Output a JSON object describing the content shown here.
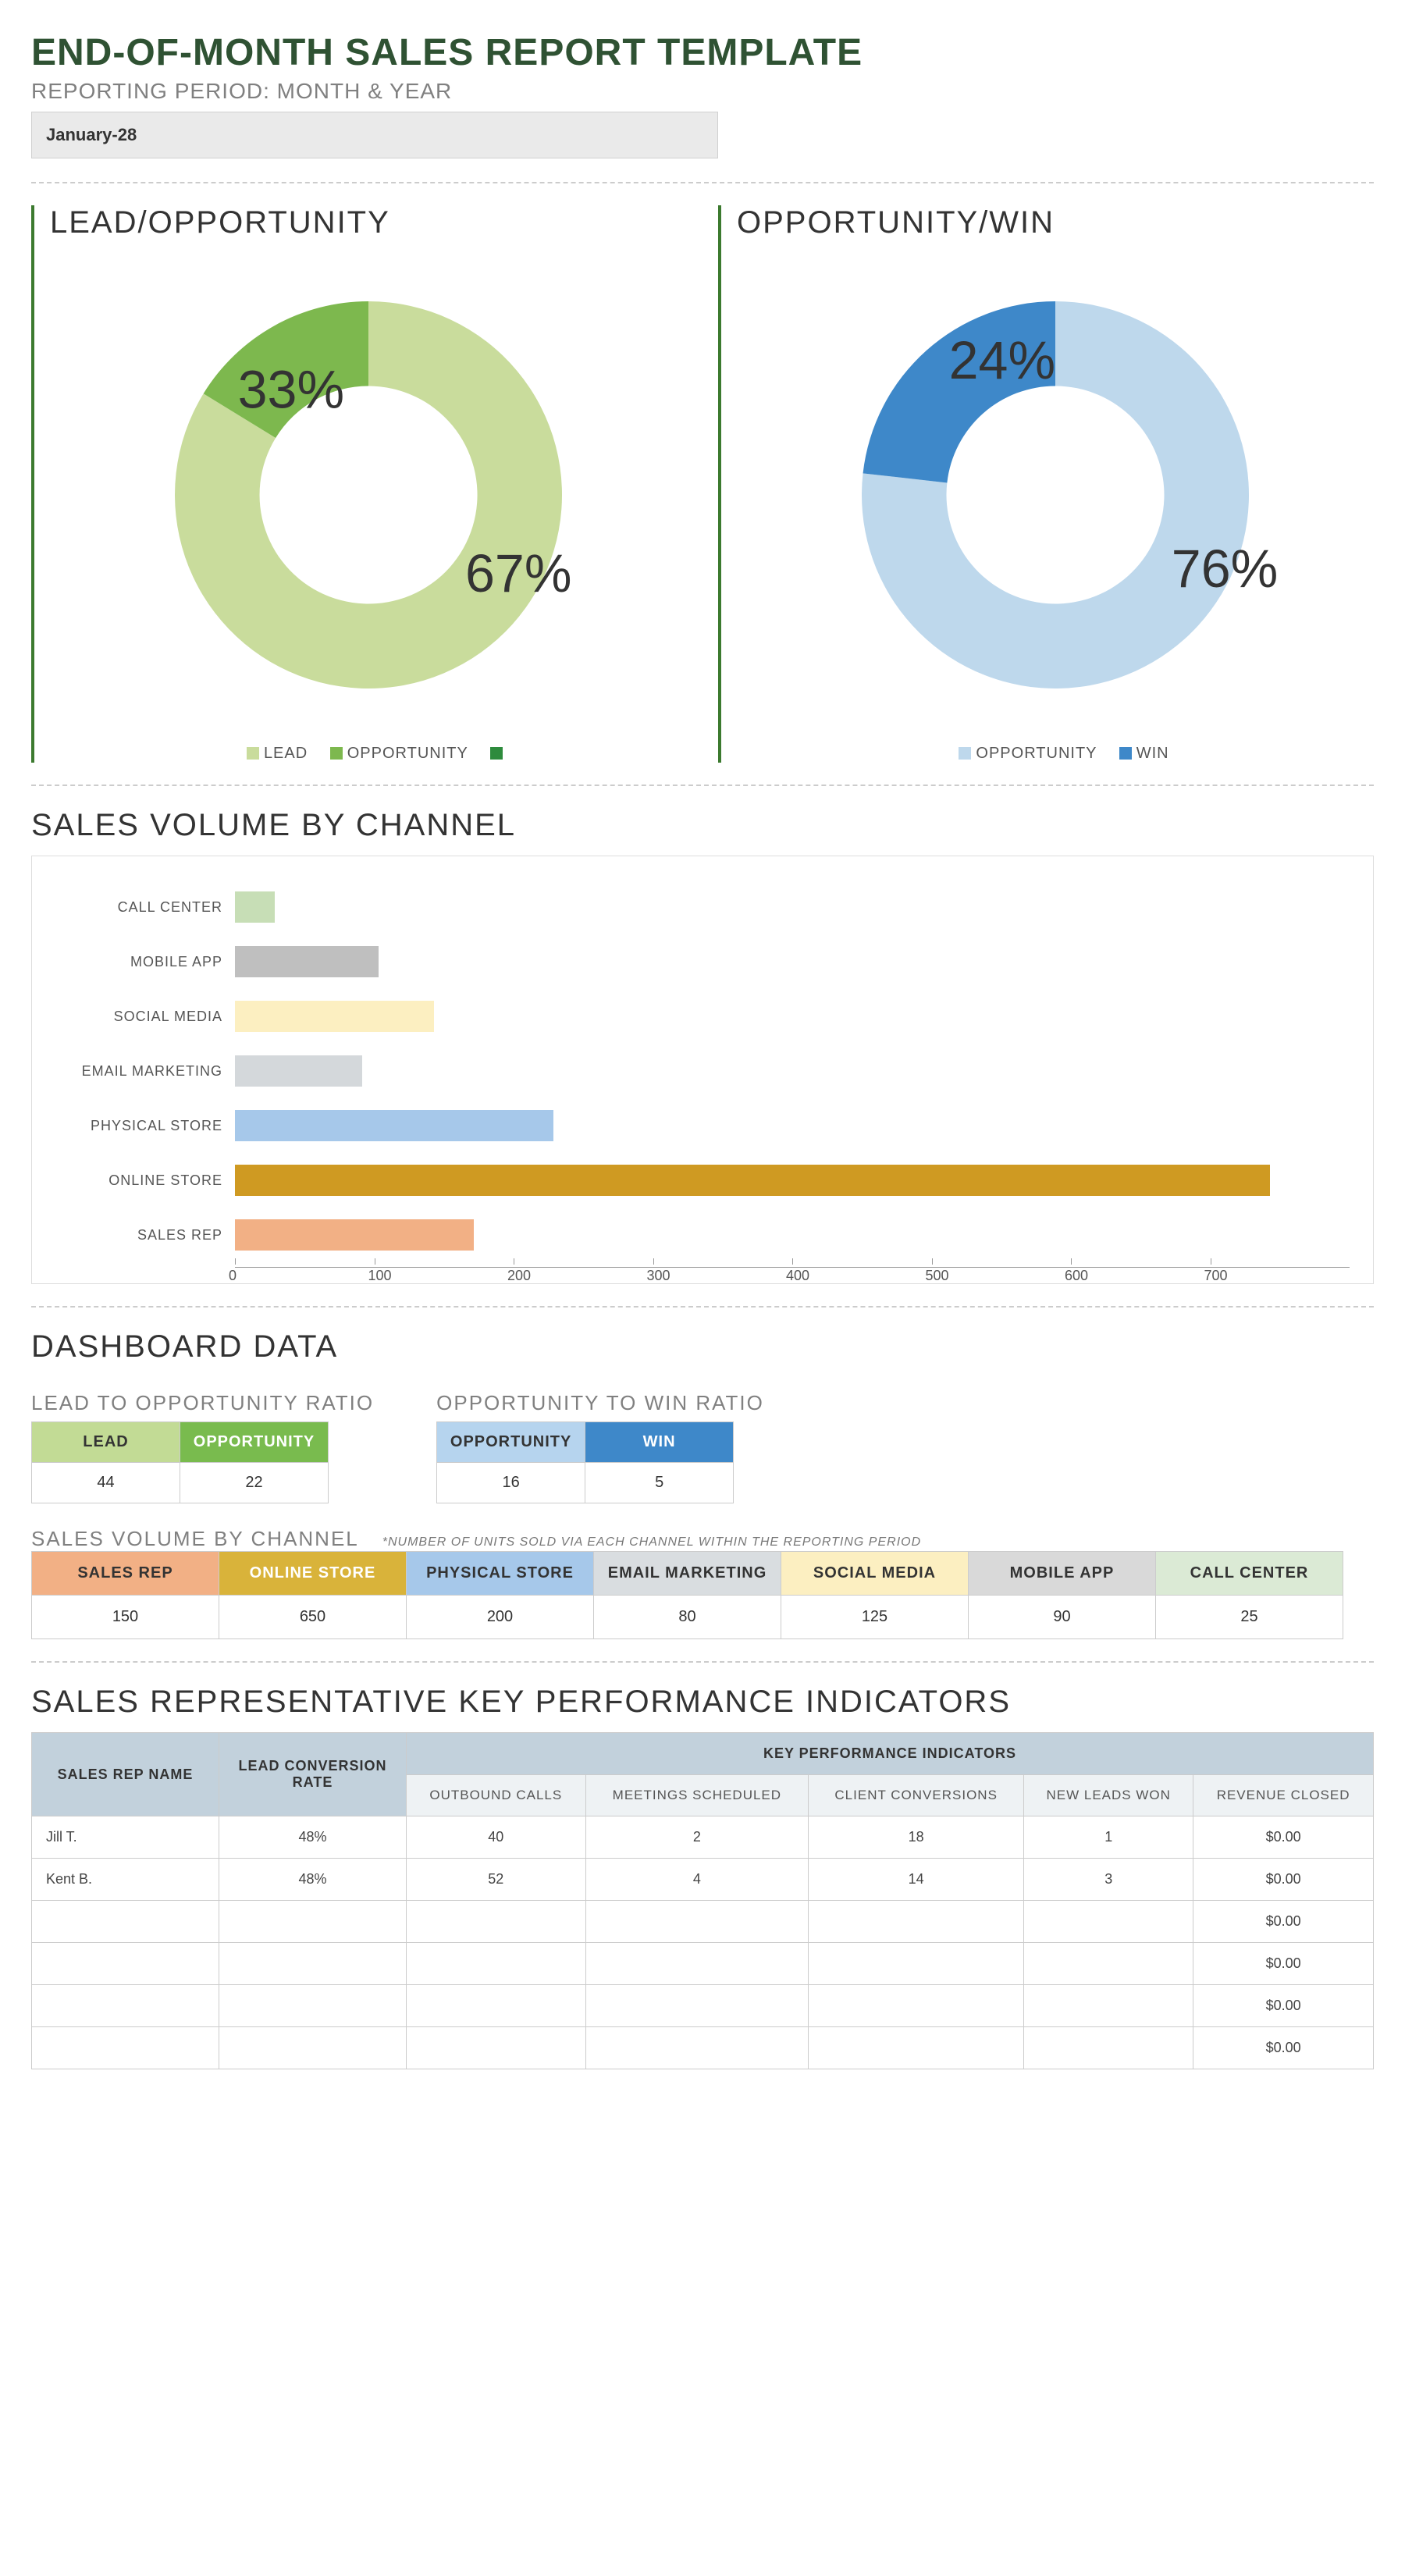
{
  "header": {
    "title": "END-OF-MONTH SALES REPORT TEMPLATE",
    "subtitle": "REPORTING PERIOD: MONTH & YEAR",
    "period": "January-28"
  },
  "donut_lead": {
    "title": "LEAD/OPPORTUNITY",
    "legend": [
      "LEAD",
      "OPPORTUNITY"
    ],
    "label_a": "67%",
    "label_b": "33%"
  },
  "donut_win": {
    "title": "OPPORTUNITY/WIN",
    "legend": [
      "OPPORTUNITY",
      "WIN"
    ],
    "label_a": "76%",
    "label_b": "24%"
  },
  "bar_section": {
    "title": "SALES VOLUME BY CHANNEL",
    "ticks": [
      "0",
      "100",
      "200",
      "300",
      "400",
      "500",
      "600",
      "700"
    ]
  },
  "dashboard": {
    "title": "DASHBOARD DATA",
    "ratio1_title": "LEAD TO OPPORTUNITY RATIO",
    "ratio1_h": [
      "LEAD",
      "OPPORTUNITY"
    ],
    "ratio1_v": [
      "44",
      "22"
    ],
    "ratio2_title": "OPPORTUNITY TO WIN RATIO",
    "ratio2_h": [
      "OPPORTUNITY",
      "WIN"
    ],
    "ratio2_v": [
      "16",
      "5"
    ],
    "channel_title": "SALES VOLUME BY CHANNEL",
    "channel_note": "*NUMBER OF UNITS SOLD VIA EACH CHANNEL WITHIN THE REPORTING PERIOD",
    "channel_h": [
      "SALES REP",
      "ONLINE STORE",
      "PHYSICAL STORE",
      "EMAIL MARKETING",
      "SOCIAL MEDIA",
      "MOBILE APP",
      "CALL CENTER"
    ],
    "channel_v": [
      "150",
      "650",
      "200",
      "80",
      "125",
      "90",
      "25"
    ]
  },
  "kpi": {
    "title": "SALES REPRESENTATIVE KEY PERFORMANCE INDICATORS",
    "h1": [
      "SALES REP NAME",
      "LEAD CONVERSION RATE",
      "KEY PERFORMANCE INDICATORS"
    ],
    "h2": [
      "OUTBOUND CALLS",
      "MEETINGS SCHEDULED",
      "CLIENT CONVERSIONS",
      "NEW LEADS WON",
      "REVENUE CLOSED"
    ],
    "rows": [
      [
        "Jill T.",
        "48%",
        "40",
        "2",
        "18",
        "1",
        "$0.00"
      ],
      [
        "Kent B.",
        "48%",
        "52",
        "4",
        "14",
        "3",
        "$0.00"
      ],
      [
        "",
        "",
        "",
        "",
        "",
        "",
        "$0.00"
      ],
      [
        "",
        "",
        "",
        "",
        "",
        "",
        "$0.00"
      ],
      [
        "",
        "",
        "",
        "",
        "",
        "",
        "$0.00"
      ],
      [
        "",
        "",
        "",
        "",
        "",
        "",
        "$0.00"
      ]
    ]
  },
  "chart_data": [
    {
      "type": "pie",
      "title": "LEAD/OPPORTUNITY",
      "series": [
        {
          "name": "LEAD",
          "value": 67,
          "color": "#c9dc9c"
        },
        {
          "name": "OPPORTUNITY",
          "value": 33,
          "color": "#7db84e"
        }
      ],
      "donut": true
    },
    {
      "type": "pie",
      "title": "OPPORTUNITY/WIN",
      "series": [
        {
          "name": "OPPORTUNITY",
          "value": 76,
          "color": "#bed8ec"
        },
        {
          "name": "WIN",
          "value": 24,
          "color": "#3e88c9"
        }
      ],
      "donut": true
    },
    {
      "type": "bar",
      "orientation": "horizontal",
      "title": "SALES VOLUME BY CHANNEL",
      "xlabel": "",
      "ylabel": "",
      "xlim": [
        0,
        700
      ],
      "categories": [
        "CALL CENTER",
        "MOBILE APP",
        "SOCIAL MEDIA",
        "EMAIL MARKETING",
        "PHYSICAL STORE",
        "ONLINE STORE",
        "SALES REP"
      ],
      "values": [
        25,
        90,
        125,
        80,
        200,
        650,
        150
      ],
      "colors": [
        "#c7deb6",
        "#bfbfbf",
        "#fcefc1",
        "#d4d8db",
        "#a6c8ea",
        "#cf9a22",
        "#f2b085"
      ]
    }
  ]
}
